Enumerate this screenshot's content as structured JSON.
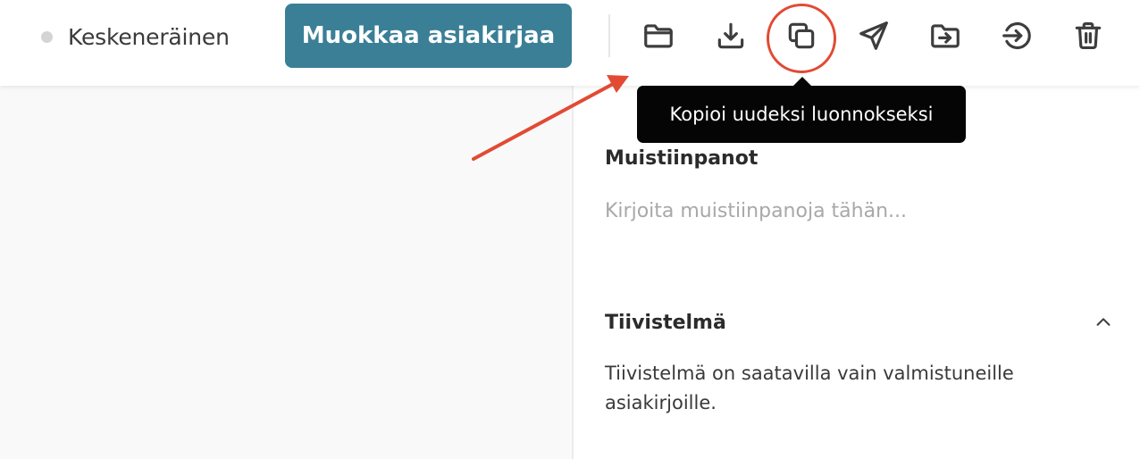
{
  "toolbar": {
    "status_label": "Keskeneräinen",
    "edit_button_label": "Muokkaa asiakirjaa",
    "icons": [
      "folder-icon",
      "download-icon",
      "copy-icon",
      "send-icon",
      "move-to-folder-icon",
      "sign-in-icon",
      "trash-icon"
    ]
  },
  "tooltip": {
    "text": "Kopioi uudeksi luonnokseksi"
  },
  "notes": {
    "title": "Muistiinpanot",
    "placeholder": "Kirjoita muistiinpanoja tähän..."
  },
  "summary": {
    "title": "Tiivistelmä",
    "text": "Tiivistelmä on saatavilla vain valmistuneille asiakirjoille."
  },
  "colors": {
    "accent": "#3b7f97",
    "annotation": "#e24a34",
    "tooltip_bg": "#050505"
  }
}
